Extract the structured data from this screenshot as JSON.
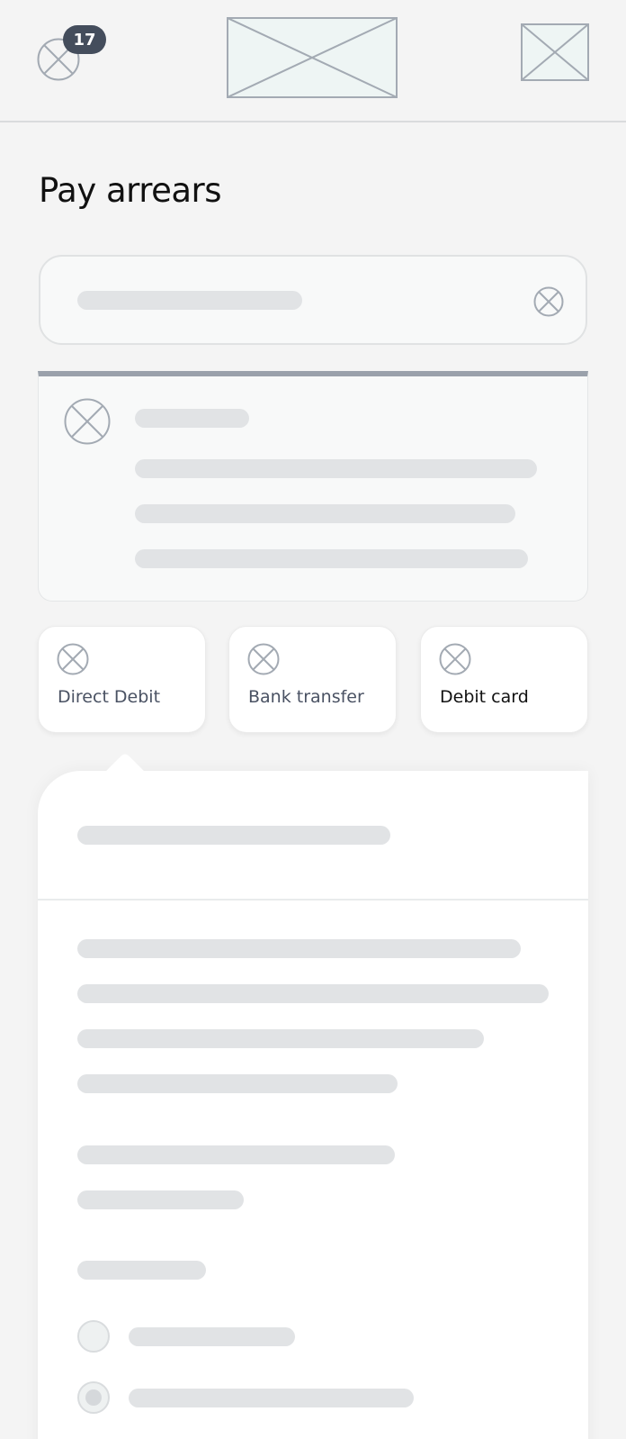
{
  "header": {
    "notification_count": "17",
    "menu_icon": "placeholder-icon",
    "logo": "image-placeholder",
    "account_image": "image-placeholder"
  },
  "page": {
    "title": "Pay arrears"
  },
  "search": {
    "clear_icon": "placeholder-icon"
  },
  "info_panel": {
    "icon": "placeholder-icon"
  },
  "payment_methods": [
    {
      "label": "Direct Debit",
      "icon": "placeholder-icon",
      "selected": false
    },
    {
      "label": "Bank transfer",
      "icon": "placeholder-icon",
      "selected": false
    },
    {
      "label": "Debit card",
      "icon": "placeholder-icon",
      "selected": true
    }
  ],
  "colors": {
    "placeholder_stroke": "#a3aab3",
    "skeleton": "#e1e3e5",
    "badge": "#444d5c",
    "panel_accent": "#9aa1ab"
  }
}
